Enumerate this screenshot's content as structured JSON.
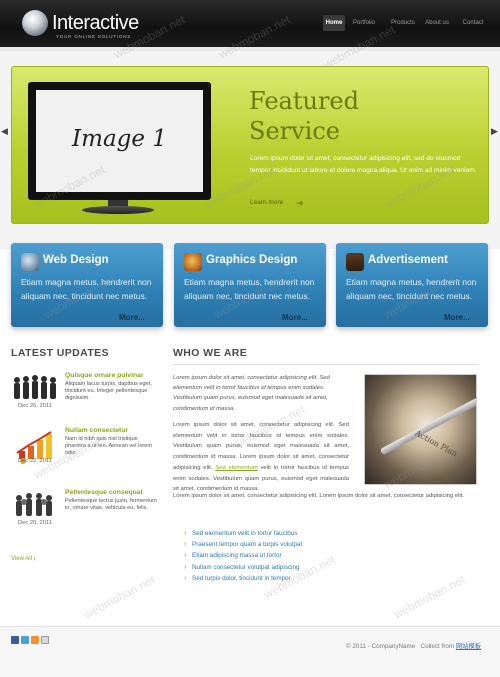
{
  "header": {
    "logo_title": "Interactive",
    "logo_tagline": "YOUR ONLINE SOLUTIONS",
    "nav": [
      "Home",
      "Portfolio",
      "Products",
      "About us",
      "Contact"
    ],
    "active_nav": "Home"
  },
  "featured": {
    "screen_label": "Image 1",
    "title_line1": "Featured",
    "title_line2": "Service",
    "text": "Lorem ipsum dolor sit amet, consectetur adipisicing elit, sed do eiusmod tempor incididunt ut labore et dolore magna aliqua. Ut enim ad minim veniam.",
    "learn_more": "Learn more",
    "prev_icon": "triangle-left",
    "next_icon": "triangle-right"
  },
  "boxes": [
    {
      "title": "Web Design",
      "text": "Etiam magna metus, hendrerit non aliquam nec, tincidunt nec metus.",
      "more": "More...",
      "icon": "globe-icon"
    },
    {
      "title": "Graphics Design",
      "text": "Etiam magna metus, hendrerit non aliquam nec, tincidunt nec metus.",
      "more": "More...",
      "icon": "palette-icon"
    },
    {
      "title": "Advertisement",
      "text": "Etiam magna metus, hendrerit non aliquam nec, tincidunt nec metus.",
      "more": "More...",
      "icon": "briefcase-icon"
    }
  ],
  "latest": {
    "heading": "LATEST UPDATES",
    "items": [
      {
        "title": "Quisque ornare pulvinar",
        "text": "Aliquam lacus turpis, dapibus eget, tincidunt eu. Integer pellentesque dignissim.",
        "date": "Dec 26, 2011"
      },
      {
        "title": "Nullam consectetur",
        "text": "Nam id nibh quis nisl tristique pharetra a ut leo. Aenean vel lorem odio.",
        "date": "Dec 22, 2011"
      },
      {
        "title": "Pellentesque consequat",
        "text": "Pellentesque lectus justo, fermentum in, ornare vitae, vehicula eu, felis.",
        "date": "Dec 20, 2011"
      }
    ],
    "view_all": "View All"
  },
  "who": {
    "heading": "WHO WE ARE",
    "intro": "Lorem ipsum dolor sit amet, consectetur adipisicing elit. Sed elementum velit in tortor faucibus id tempus enim sodales. Vestibulum quam purus, euismod eget malesuada sit amet, condimentum id massa.",
    "body_before_link": "Lorem ipsum dolor sit amet, consectetur adipisicing elit. Sed elementum velit in tortor faucibus id tempus enim sodales. Vestibulum quam purus, euismod eget malesuada sit amet, condimentum id massa. Lorem ipsum dolor sit amet, consectetur adipisicing elit.",
    "body_link": "Sed elementum",
    "body_after_link": "velit in tortor faucibus id tempus enim sodales. Vestibulum quam purus, euismod eget malesuada sit amet, condimentum id massa.",
    "body_tail": "Lorem ipsum dolor sit amet, consectetur adipisicing elit. Lorem ipsum dolor sit amet, consectetur adipisicing elit.",
    "photo_text": "Action Plan",
    "bullets": [
      "Sed elementum velit in tortor faucibus",
      "Praesent tempor quam a turpis volutpat",
      "Etiam adipiscing massa ut tortor",
      "Nullam consectetur volutpat adipiscing",
      "Sed turpis dolor, tincidunt in tempor"
    ]
  },
  "footer": {
    "copyright": "© 2011 - CompanyName",
    "collect_label": "Collect from",
    "collect_link": "网站模板",
    "social_icons": [
      "facebook-icon",
      "twitter-icon",
      "rss-icon",
      "email-icon"
    ]
  },
  "watermark": "webmoban.net",
  "colors": {
    "header_bg": "#111111",
    "featured_green": "#b9d030",
    "box_blue": "#2e7fb4",
    "accent_green": "#8aa717",
    "link_blue": "#2f79a9"
  }
}
